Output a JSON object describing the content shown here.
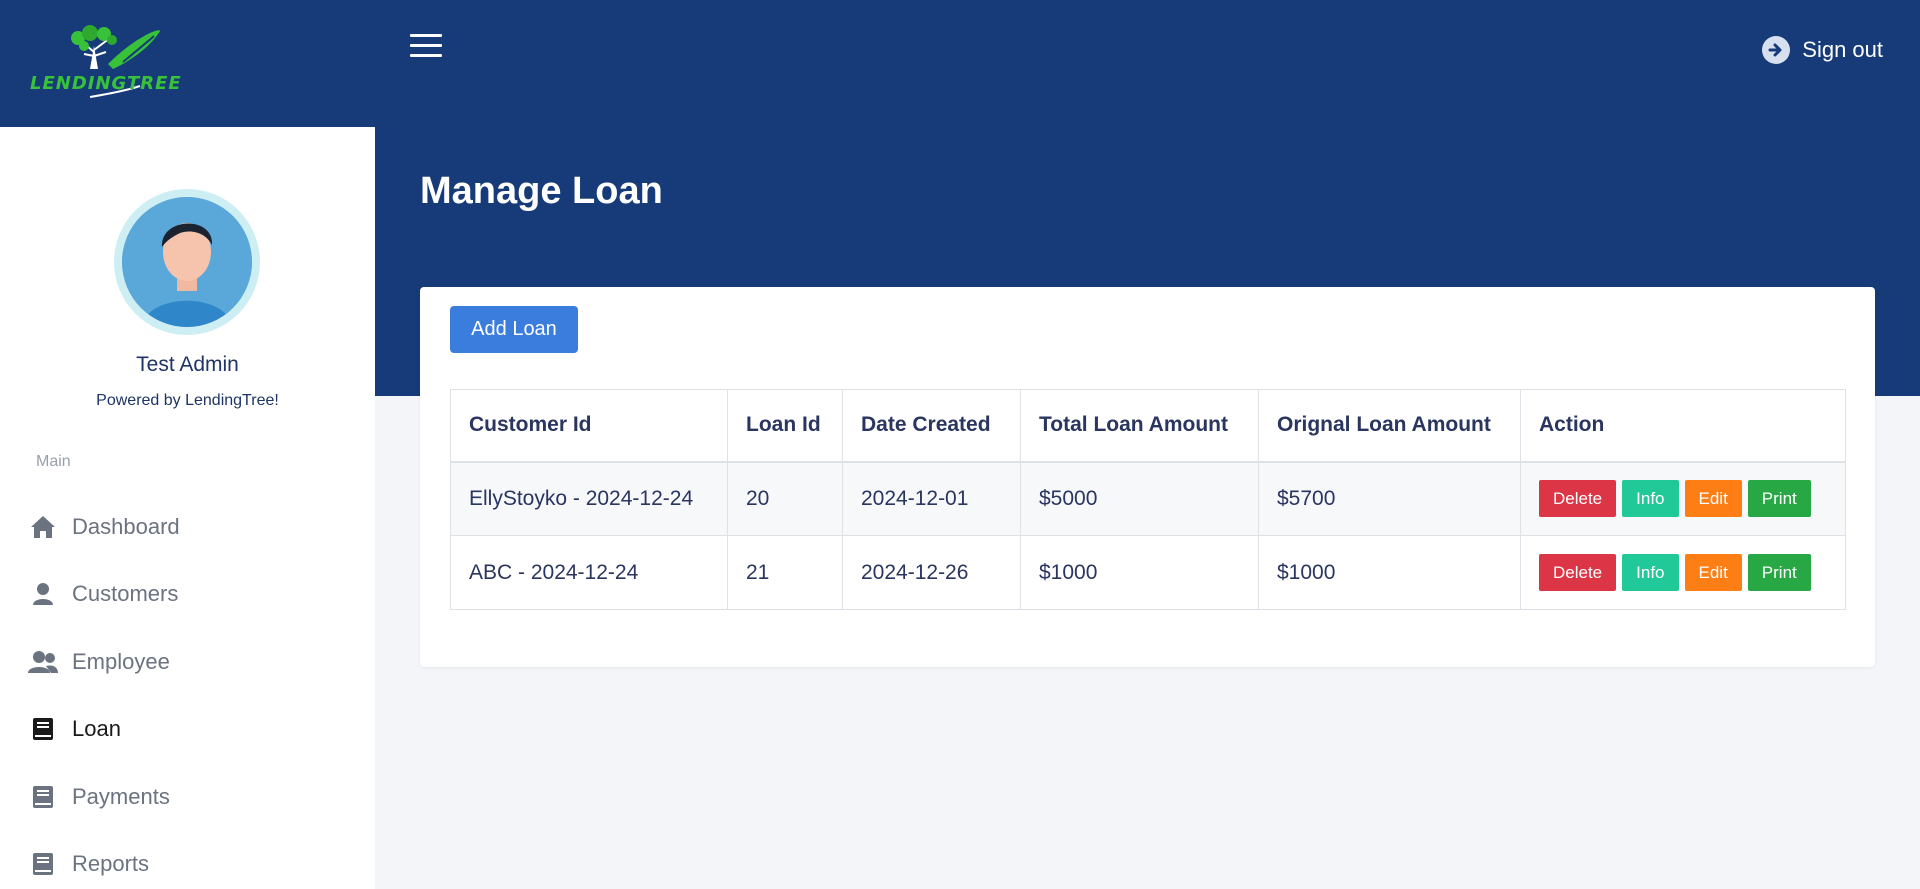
{
  "brand": {
    "logo_text": "LENDINGTREE",
    "logo_green": "#37c23a",
    "header_bg": "#163b78"
  },
  "header": {
    "signout_label": "Sign out"
  },
  "sidebar": {
    "user_name": "Test Admin",
    "powered_by": "Powered by LendingTree!",
    "section_label": "Main",
    "items": [
      {
        "label": "Dashboard",
        "icon": "home-icon"
      },
      {
        "label": "Customers",
        "icon": "user-icon"
      },
      {
        "label": "Employee",
        "icon": "users-icon"
      },
      {
        "label": "Loan",
        "icon": "book-icon",
        "active": true
      },
      {
        "label": "Payments",
        "icon": "book-icon"
      },
      {
        "label": "Reports",
        "icon": "book-icon"
      }
    ]
  },
  "main": {
    "title": "Manage Loan",
    "add_button": "Add Loan",
    "table": {
      "headers": [
        "Customer Id",
        "Loan Id",
        "Date Created",
        "Total Loan Amount",
        "Orignal Loan Amount",
        "Action"
      ],
      "rows": [
        [
          "EllyStoyko - 2024-12-24",
          "20",
          "2024-12-01",
          "$5000",
          "$5700"
        ],
        [
          "ABC - 2024-12-24",
          "21",
          "2024-12-26",
          "$1000",
          "$1000"
        ]
      ],
      "actions": [
        "Delete",
        "Info",
        "Edit",
        "Print"
      ]
    }
  }
}
